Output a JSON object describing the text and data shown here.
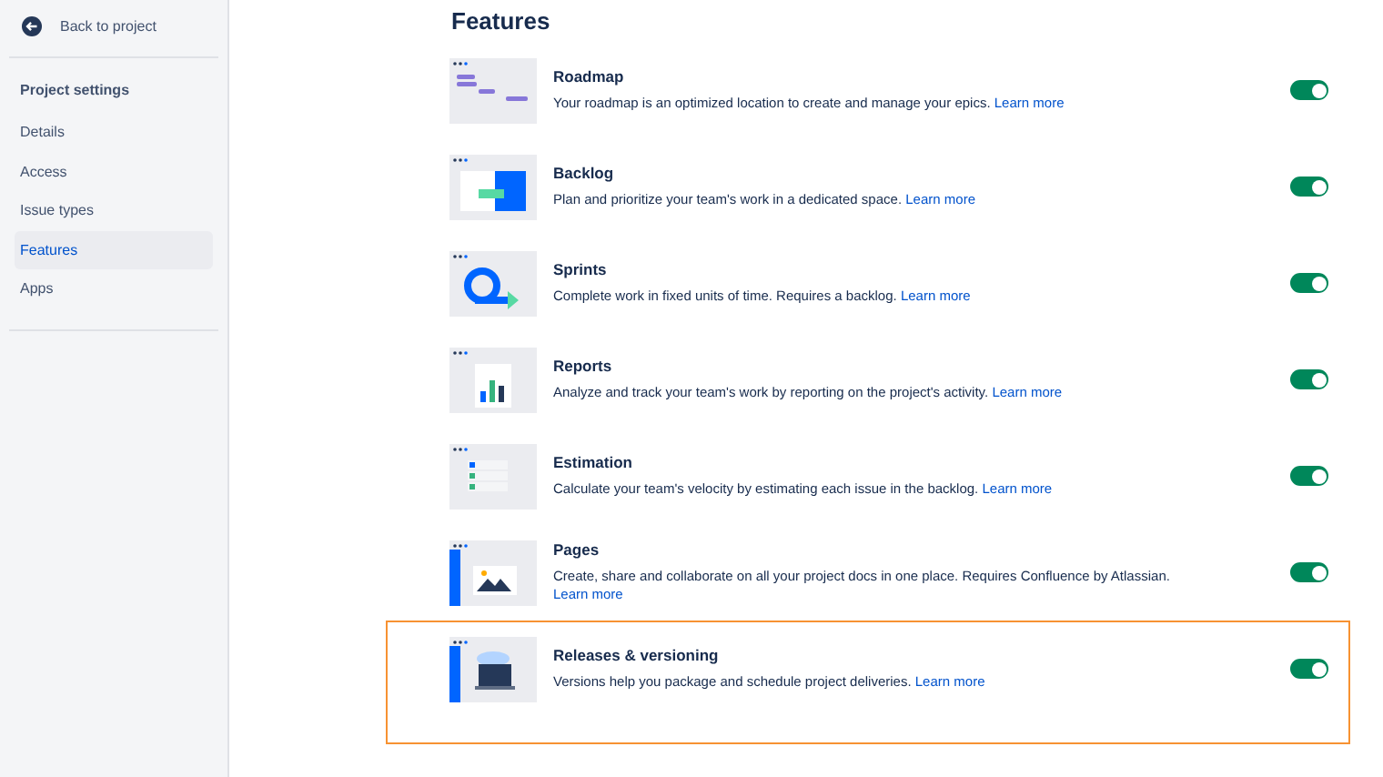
{
  "sidebar": {
    "back": {
      "label": "Back to project"
    },
    "section_title": "Project settings",
    "items": [
      {
        "label": "Details",
        "selected": false
      },
      {
        "label": "Access",
        "selected": false
      },
      {
        "label": "Issue types",
        "selected": false
      },
      {
        "label": "Features",
        "selected": true
      },
      {
        "label": "Apps",
        "selected": false
      }
    ]
  },
  "main": {
    "heading": "Features",
    "features": [
      {
        "kind": "roadmap",
        "title": "Roadmap",
        "description": "Your roadmap is an optimized location to create and manage your epics.",
        "link": "Learn more",
        "on": true,
        "highlighted": false
      },
      {
        "kind": "backlog",
        "title": "Backlog",
        "description": "Plan and prioritize your team's work in a dedicated space.",
        "link": "Learn more",
        "on": true,
        "highlighted": false
      },
      {
        "kind": "sprints",
        "title": "Sprints",
        "description": "Complete work in fixed units of time. Requires a backlog.",
        "link": "Learn more",
        "on": true,
        "highlighted": false
      },
      {
        "kind": "reports",
        "title": "Reports",
        "description": "Analyze and track your team's work by reporting on the project's activity.",
        "link": "Learn more",
        "on": true,
        "highlighted": false
      },
      {
        "kind": "estimation",
        "title": "Estimation",
        "description": "Calculate your team's velocity by estimating each issue in the backlog.",
        "link": "Learn more",
        "on": true,
        "highlighted": false
      },
      {
        "kind": "pages",
        "title": "Pages",
        "description": "Create, share and collaborate on all your project docs in one place. Requires Confluence by Atlassian.",
        "link": "Learn more",
        "on": true,
        "highlighted": false
      },
      {
        "kind": "releases",
        "title": "Releases & versioning",
        "description": "Versions help you package and schedule project deliveries.",
        "link": "Learn more",
        "on": true,
        "highlighted": true
      }
    ]
  }
}
